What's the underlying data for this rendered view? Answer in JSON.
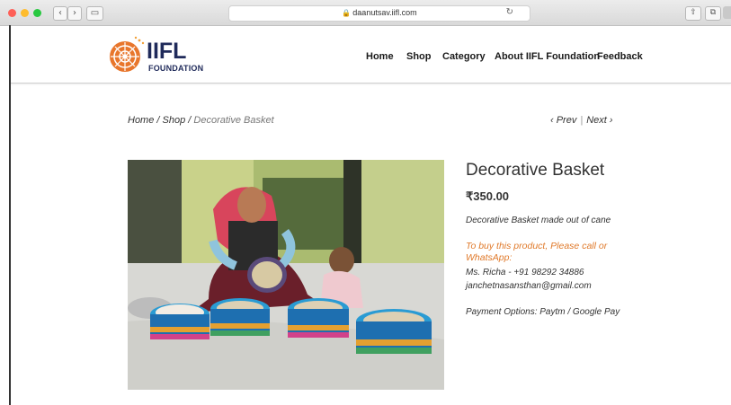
{
  "browser": {
    "url": "daanutsav.iifl.com",
    "back_glyph": "‹",
    "forward_glyph": "›",
    "sidebar_glyph": "▭",
    "lock_glyph": "🔒",
    "reload_glyph": "↻",
    "share_glyph": "⇧",
    "tabs_glyph": "⧉"
  },
  "header": {
    "logo": {
      "main": "IIFL",
      "sub": "FOUNDATION"
    },
    "nav": [
      "Home",
      "Shop",
      "Category",
      "About IIFL Foundation",
      "Feedback"
    ]
  },
  "breadcrumb": {
    "home": "Home",
    "sep": " / ",
    "shop": "Shop",
    "current": "Decorative Basket"
  },
  "pager": {
    "prev": "‹  Prev",
    "next": "Next  ›",
    "sep": "|"
  },
  "product": {
    "title": "Decorative Basket",
    "price": "₹350.00",
    "description": "Decorative Basket made out of cane",
    "buy_note": "To buy this product, Please call or WhatsApp:",
    "contact_name": "Ms. Richa - +91 98292 34886",
    "contact_email": "janchetnasansthan@gmail.com",
    "payment": "Payment Options: Paytm / Google Pay"
  },
  "colors": {
    "accent_orange": "#e07a2b",
    "logo_navy": "#1f2a5a"
  }
}
